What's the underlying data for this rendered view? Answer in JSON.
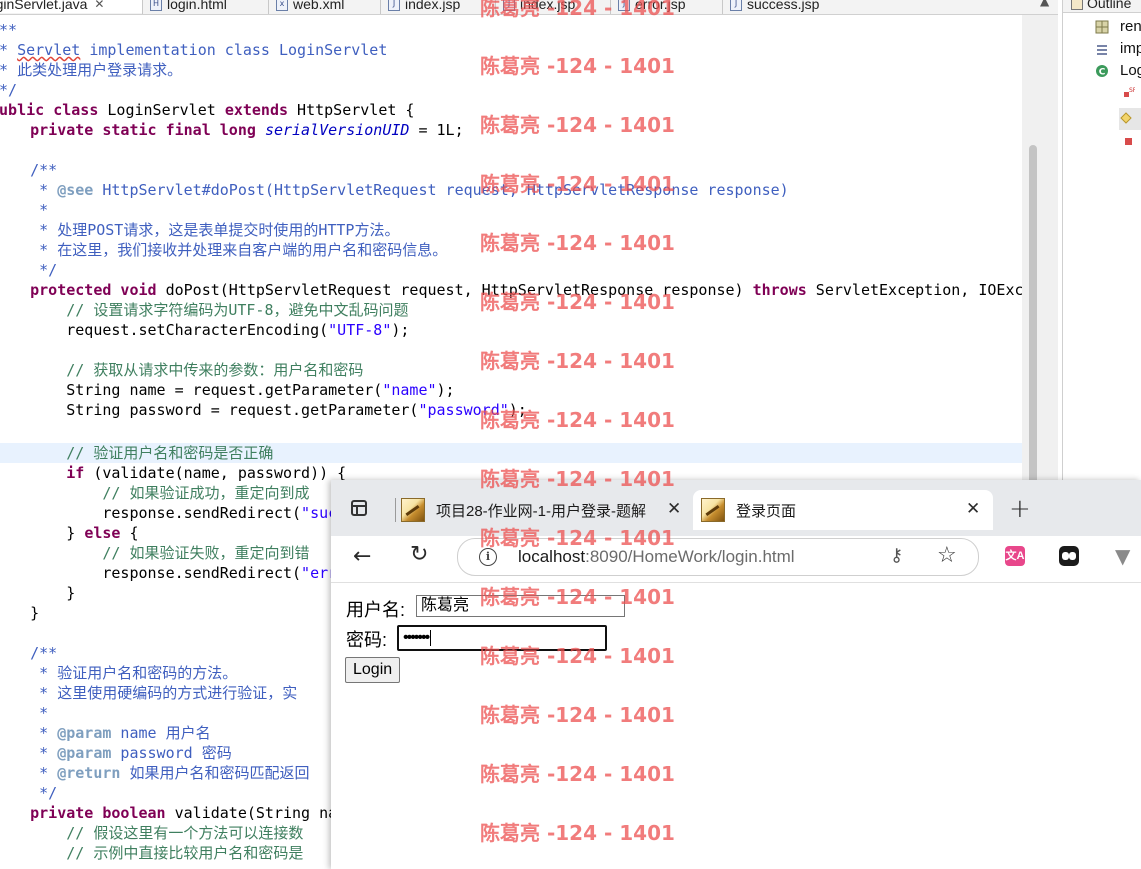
{
  "editor_tabs": [
    {
      "label": "LoginServlet.java",
      "active": true
    },
    {
      "label": "login.html"
    },
    {
      "label": "web.xml"
    },
    {
      "label": "index.jsp"
    },
    {
      "label": "index.jsp"
    },
    {
      "label": "error.jsp"
    },
    {
      "label": "success.jsp"
    }
  ],
  "code": {
    "l01": "/**",
    "l02a": " * ",
    "l02b": "Servlet",
    "l02c": " implementation class LoginServlet",
    "l03": " * 此类处理用户登录请求。",
    "l04": " */",
    "l05a": "public class",
    "l05b": " LoginServlet ",
    "l05c": "extends",
    "l05d": " HttpServlet {",
    "l06a": "    private static final long",
    "l06b": " ",
    "l06c": "serialVersionUID",
    "l06d": " = 1L;",
    "l08": "    /**",
    "l09a": "     * ",
    "l09b": "@see",
    "l09c": " HttpServlet#doPost(HttpServletRequest request, HttpServletResponse response)",
    "l10": "     *",
    "l11": "     * 处理POST请求，这是表单提交时使用的HTTP方法。",
    "l12": "     * 在这里，我们接收并处理来自客户端的用户名和密码信息。",
    "l13": "     */",
    "l14a": "    protected void",
    "l14b": " doPost(HttpServletRequest request, HttpServletResponse response) ",
    "l14c": "throws",
    "l14d": " ServletException, IOException",
    "l15": "        // 设置请求字符编码为UTF-8，避免中文乱码问题",
    "l16a": "        request.setCharacterEncoding(",
    "l16b": "\"UTF-8\"",
    "l16c": ");",
    "l18": "        // 获取从请求中传来的参数：用户名和密码",
    "l19a": "        String name = request.getParameter(",
    "l19b": "\"name\"",
    "l19c": ");",
    "l20a": "        String password = request.getParameter(",
    "l20b": "\"password\"",
    "l20c": ");",
    "l22": "        // 验证用户名和密码是否正确",
    "l23a": "        if",
    "l23b": " (validate(name, password)) {",
    "l24": "            // 如果验证成功，重定向到成",
    "l25a": "            response.sendRedirect(",
    "l25b": "\"suc",
    "l26a": "        } ",
    "l26b": "else",
    "l26c": " {",
    "l27": "            // 如果验证失败，重定向到错",
    "l28a": "            response.sendRedirect(",
    "l28b": "\"err",
    "l29": "        }",
    "l30": "    }",
    "l32": "    /**",
    "l33": "     * 验证用户名和密码的方法。",
    "l34": "     * 这里使用硬编码的方式进行验证，实",
    "l35": "     *",
    "l36a": "     * ",
    "l36b": "@param",
    "l36c": " name 用户名",
    "l37a": "     * ",
    "l37b": "@param",
    "l37c": " password 密码",
    "l38a": "     * ",
    "l38b": "@return",
    "l38c": " 如果用户名和密码匹配返回",
    "l39": "     */",
    "l40a": "    private boolean",
    "l40b": " validate(String na",
    "l41": "        // 假设这里有一个方法可以连接数",
    "l42": "        // 示例中直接比较用户名和密码是"
  },
  "outline": {
    "title": "Outline",
    "items": [
      "ren",
      "imp",
      "Log"
    ]
  },
  "browser": {
    "tabs": [
      {
        "label": "项目28-作业网-1-用户登录-题解"
      },
      {
        "label": "登录页面",
        "active": true
      }
    ],
    "url_host": "localhost",
    "url_rest": ":8090/HomeWork/login.html",
    "translate_icon_text": "文A",
    "page": {
      "username_label": "用户名:",
      "username_value": "陈葛亮",
      "password_label": "密码:",
      "password_value": "•••••••",
      "login_button": "Login"
    }
  },
  "watermark": "陈葛亮 -124 - 1401"
}
